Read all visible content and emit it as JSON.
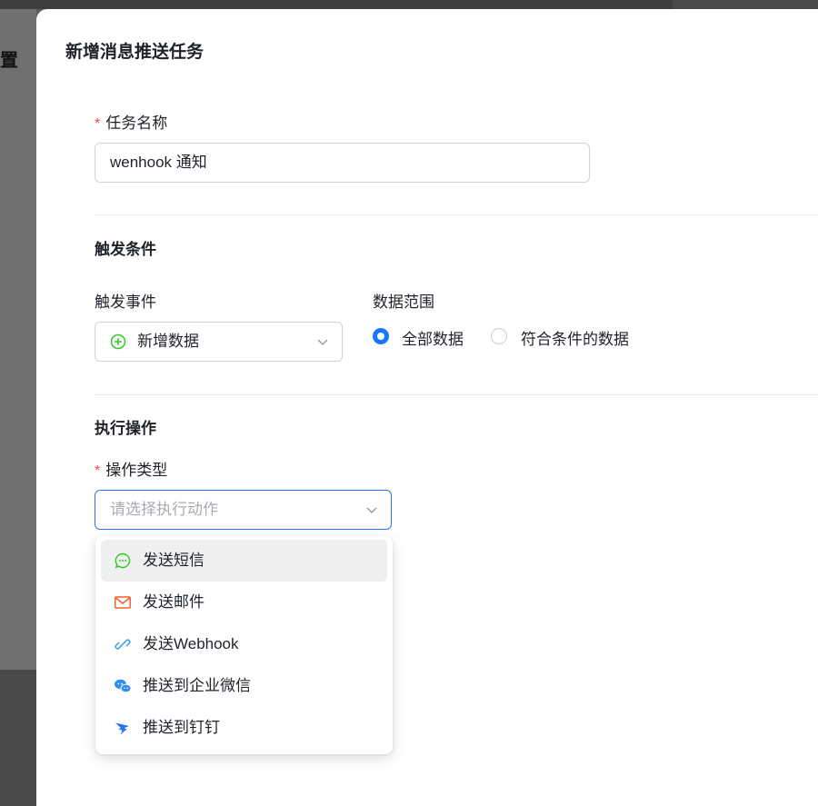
{
  "background": {
    "crumb_fragment": "置"
  },
  "drawer": {
    "title": "新增消息推送任务",
    "task_name": {
      "label": "任务名称",
      "required_mark": "*",
      "value": "wenhook 通知"
    },
    "trigger": {
      "section_title": "触发条件",
      "event_label": "触发事件",
      "event_value": "新增数据",
      "scope_label": "数据范围",
      "scope_options": [
        {
          "label": "全部数据",
          "selected": true
        },
        {
          "label": "符合条件的数据",
          "selected": false
        }
      ]
    },
    "action": {
      "section_title": "执行操作",
      "type_label": "操作类型",
      "required_mark": "*",
      "type_placeholder": "请选择执行动作",
      "options": [
        {
          "label": "发送短信",
          "icon": "sms-icon",
          "hovered": true
        },
        {
          "label": "发送邮件",
          "icon": "mail-icon",
          "hovered": false
        },
        {
          "label": "发送Webhook",
          "icon": "webhook-icon",
          "hovered": false
        },
        {
          "label": "推送到企业微信",
          "icon": "wecom-icon",
          "hovered": false
        },
        {
          "label": "推送到钉钉",
          "icon": "dingtalk-icon",
          "hovered": false
        }
      ]
    }
  },
  "colors": {
    "primary": "#1677ff",
    "required": "#f54a45",
    "sms": "#34c724",
    "mail": "#f5602a",
    "webhook": "#3b9ce9",
    "wecom": "#2f8cf0",
    "dingtalk": "#2672ef"
  }
}
